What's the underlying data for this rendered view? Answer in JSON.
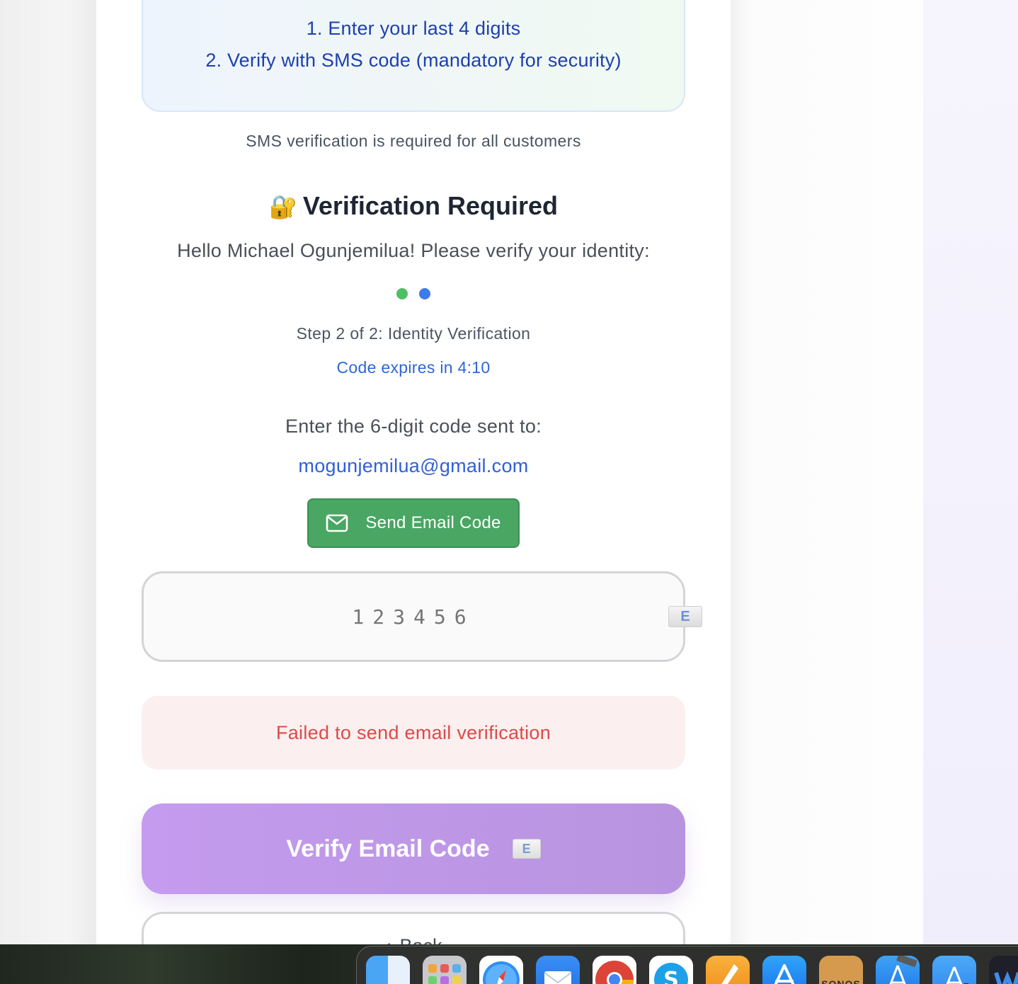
{
  "info_box": {
    "line1": "1. Enter your last 4 digits",
    "line2": "2. Verify with SMS code (mandatory for security)"
  },
  "sms_note": "SMS verification is required for all customers",
  "title": {
    "icon": "lock-with-key-icon",
    "icon_glyph": "🔐",
    "text": "Verification Required"
  },
  "greeting": "Hello Michael Ogunjemilua! Please verify your identity:",
  "progress": {
    "steps_total": 2,
    "current_step": 2,
    "colors": [
      "#4fbf64",
      "#3f7be6"
    ]
  },
  "step_label": "Step 2 of 2: Identity Verification",
  "expires_label": "Code expires in 4:10",
  "enter_label": "Enter the 6-digit code sent to:",
  "email": "mogunjemilua@gmail.com",
  "send_button": {
    "icon": "envelope-icon",
    "label": "Send Email Code",
    "color": "#4aa663"
  },
  "code_input": {
    "placeholder": "123456",
    "value": "",
    "icon": "email-envelope-icon"
  },
  "error": {
    "message": "Failed to send email verification",
    "color": "#dd4a4a"
  },
  "verify_button": {
    "label": "Verify Email Code",
    "icon": "email-envelope-icon",
    "color": "#c49bee"
  },
  "back_button": {
    "label": "Back",
    "icon": "chevron-left-icon"
  },
  "dock": {
    "apps": [
      "Finder",
      "Launchpad",
      "Safari",
      "Mail",
      "Chrome",
      "Skype",
      "Pages",
      "App Store",
      "SONOS",
      "Xcode",
      "Instruments",
      "Webex"
    ],
    "sonos_label": "SONOS"
  }
}
